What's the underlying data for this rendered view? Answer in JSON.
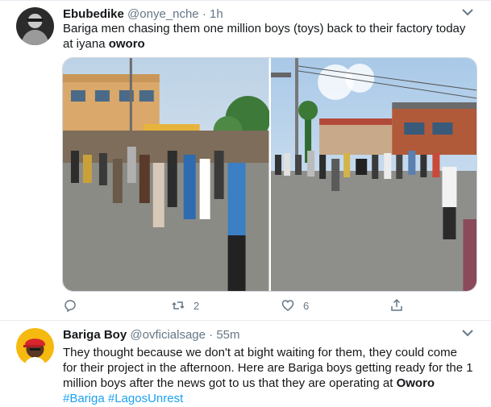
{
  "tweets": [
    {
      "name": "Ebubedike",
      "handle": "@onye_nche",
      "dot": "·",
      "time": "1h",
      "text_before": "Bariga men chasing them one million boys (toys) back to their factory today at iyana ",
      "text_bold": "oworo",
      "actions": {
        "reply_count": "",
        "retweet_count": "2",
        "like_count": "6"
      }
    },
    {
      "name": "Bariga Boy",
      "handle": "@ovficialsage",
      "dot": "·",
      "time": "55m",
      "text_before": "They thought because we don't at bight waiting for them, they could come for their project in the afternoon. Here are Bariga boys getting ready for the 1 million boys after the news got to us that they are operating at ",
      "text_bold": "Oworo",
      "hashtag1": "#Bariga",
      "hashtag2": "#LagosUnrest"
    }
  ],
  "icons": {
    "caret": "chevron-down-icon",
    "reply": "reply-icon",
    "retweet": "retweet-icon",
    "like": "heart-icon",
    "share": "share-icon"
  },
  "colors": {
    "text": "#14171a",
    "muted": "#657786",
    "link": "#1da1f2",
    "divider": "#e6ecf0"
  }
}
